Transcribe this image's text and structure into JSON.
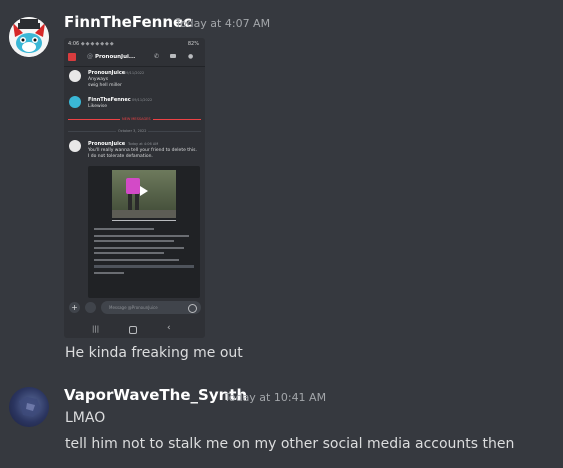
{
  "messages": [
    {
      "username": "FinnTheFennec",
      "timestamp": "Today at 4:07 AM",
      "text": "He kinda freaking me out"
    },
    {
      "username": "VaporWaveThe_Synth",
      "timestamp": "Today at 10:41 AM",
      "lines": [
        "LMAO",
        "tell him not to stalk me on my other social media accounts then"
      ]
    }
  ],
  "embed": {
    "status_time": "4:06",
    "battery": "82%",
    "channel": "PronounJui...",
    "posts": [
      {
        "name": "PronounJuice",
        "ts": "09/11/2022",
        "lines": [
          "Anyways",
          "swig hell miller"
        ]
      },
      {
        "name": "FinnTheFennec",
        "ts": "09/11/2022",
        "lines": [
          "Likewise"
        ]
      },
      {
        "name": "PronounJuice",
        "ts": "Today at 4:06 AM",
        "lines": [
          "You'll really wanna tell your friend to delete this.",
          "I do not tolerate defamation."
        ]
      }
    ],
    "new_messages": "NEW MESSAGES",
    "date_divider": "October 3, 2022",
    "input_placeholder": "Message @PronounJuice"
  },
  "colors": {
    "background": "#36393f",
    "username": "#ffffff",
    "timestamp": "#a3a6aa",
    "new_messages": "#ed4245"
  }
}
